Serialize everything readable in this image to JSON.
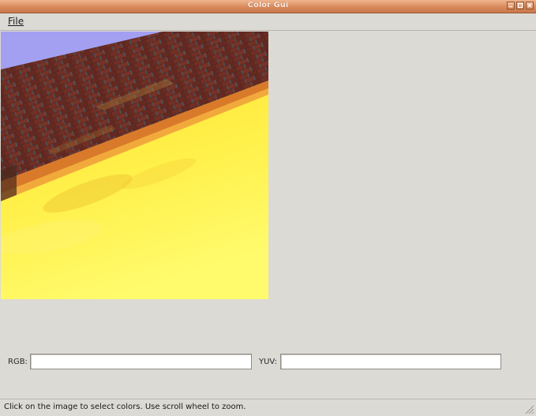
{
  "window": {
    "title": "Color Gui"
  },
  "menubar": {
    "file_label": "File"
  },
  "fields": {
    "rgb": {
      "label": "RGB:",
      "value": ""
    },
    "yuv": {
      "label": "YUV:",
      "value": ""
    }
  },
  "statusbar": {
    "text": "Click on the image to select colors. Use scroll wheel to zoom."
  }
}
